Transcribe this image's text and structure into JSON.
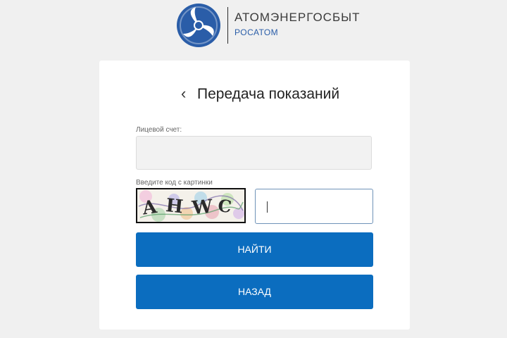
{
  "header": {
    "brand_name": "АТОМЭНЕРГОСБЫТ",
    "brand_sub": "РОСАТОМ",
    "emblem_icon": "rosatom-emblem-icon"
  },
  "form": {
    "back_icon": "chevron-left-icon",
    "back_glyph": "‹",
    "title": "Передача показаний",
    "account_label": "Лицевой счет:",
    "account_value": "",
    "captcha_label": "Введите код с картинки",
    "captcha_text": "AHWC",
    "captcha_value": ""
  },
  "buttons": {
    "find": "НАЙТИ",
    "back": "НАЗАД"
  },
  "colors": {
    "brand_blue": "#0b6dbf",
    "brand_sub": "#2a5da8",
    "page_bg": "#f0f0f0"
  }
}
